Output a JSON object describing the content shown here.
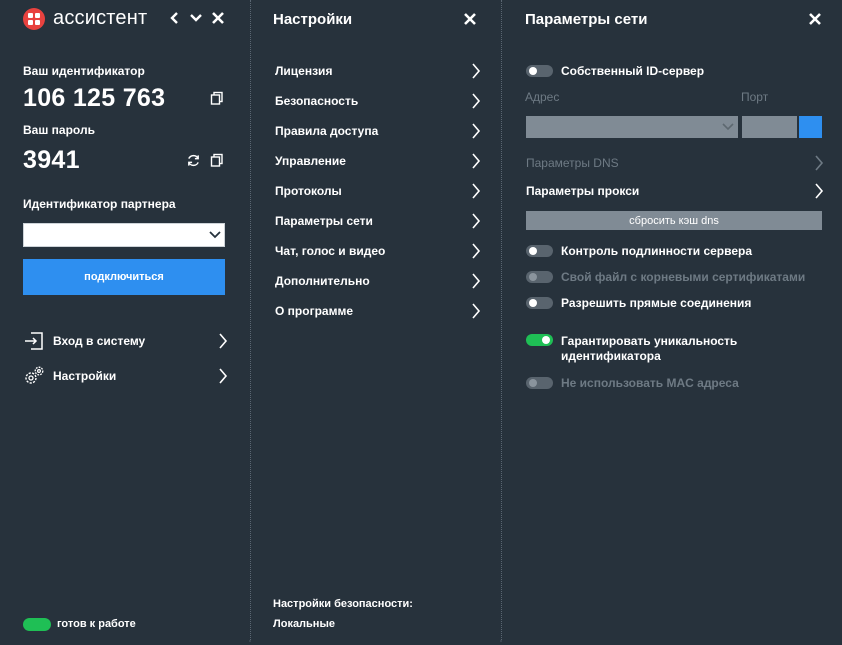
{
  "app": {
    "title": "ассистент"
  },
  "left": {
    "id_label": "Ваш идентификатор",
    "id_value": "106 125 763",
    "password_label": "Ваш пароль",
    "password_value": "3941",
    "partner_label": "Идентификатор партнера",
    "partner_value": "",
    "connect_label": "подключиться",
    "nav": [
      {
        "label": "Вход в систему",
        "icon": "login-icon"
      },
      {
        "label": "Настройки",
        "icon": "gear-icon"
      }
    ],
    "status_text": "готов к работе",
    "status_color": "#1fbf55"
  },
  "settings": {
    "title": "Настройки",
    "items": [
      {
        "label": "Лицензия"
      },
      {
        "label": "Безопасность"
      },
      {
        "label": "Правила доступа"
      },
      {
        "label": "Управление"
      },
      {
        "label": "Протоколы"
      },
      {
        "label": "Параметры сети"
      },
      {
        "label": "Чат, голос и видео"
      },
      {
        "label": "Дополнительно"
      },
      {
        "label": "О программе"
      }
    ],
    "footer_label": "Настройки безопасности:",
    "footer_value": "Локальные"
  },
  "network": {
    "title": "Параметры сети",
    "own_server_label": "Собственный ID-сервер",
    "address_label": "Адрес",
    "port_label": "Порт",
    "dns_label": "Параметры DNS",
    "proxy_label": "Параметры прокси",
    "reset_dns_label": "сбросить кэш dns",
    "toggles": [
      {
        "label": "Контроль подлинности сервера",
        "on": false,
        "enabled": true
      },
      {
        "label": "Свой файл с корневыми сертификатами",
        "on": false,
        "enabled": false
      },
      {
        "label": "Разрешить прямые соединения",
        "on": false,
        "enabled": true
      },
      {
        "label": "Гарантировать уникальность идентификатора",
        "on": true,
        "enabled": true
      },
      {
        "label": "Не использовать MAC адреса",
        "on": false,
        "enabled": false
      }
    ]
  },
  "colors": {
    "background": "#27323c",
    "accent": "#2e8ff0",
    "success": "#1fbf55",
    "logo": "#e8423f"
  }
}
